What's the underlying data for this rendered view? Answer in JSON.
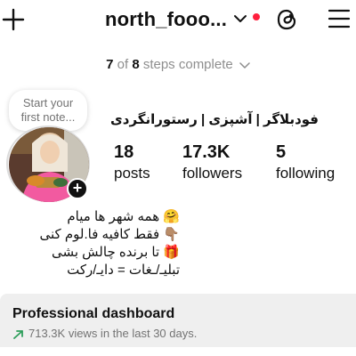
{
  "header": {
    "username": "north_fooo...",
    "icons": [
      "plus-icon",
      "chevron-down-icon",
      "notification-dot",
      "threads-icon",
      "menu-icon"
    ],
    "dot_color": "#ff1f3d"
  },
  "steps": {
    "done": "7",
    "of": "of",
    "total": "8",
    "label": "steps complete"
  },
  "note": {
    "placeholder_line1": "Start your",
    "placeholder_line2": "first note..."
  },
  "profile": {
    "display_name": "فودبلاگر | آشپزی | رستورانگردی",
    "stats": [
      {
        "value": "18",
        "label": "posts"
      },
      {
        "value": "17.3K",
        "label": "followers"
      },
      {
        "value": "5",
        "label": "following"
      }
    ],
    "bio": [
      "🤗 همه شهر ها میام",
      "👇🏽 فقط کافیه فا.لوم کنی",
      "🎁 تا برنده چالش بشی",
      "تبلیـ/ـغات = دایـ/رکت"
    ]
  },
  "dashboard": {
    "title": "Professional dashboard",
    "views": "713.3K views in the last 30 days.",
    "trend_color": "#2e9e5b"
  }
}
